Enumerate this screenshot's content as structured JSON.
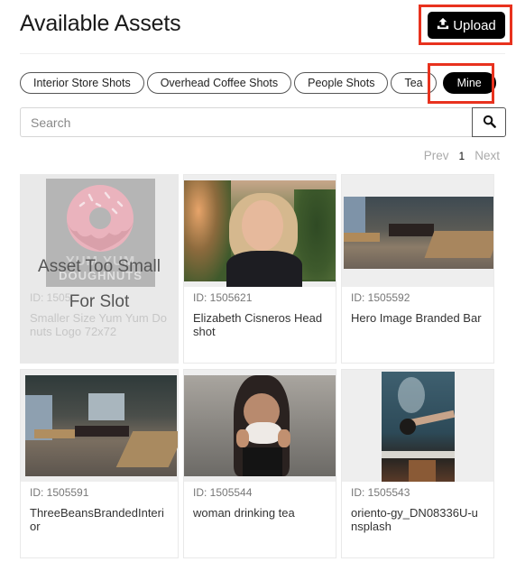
{
  "header": {
    "title": "Available Assets",
    "upload_label": "Upload",
    "upload_icon": "upload-icon"
  },
  "filters": [
    {
      "label": "Interior Store Shots",
      "active": false
    },
    {
      "label": "Overhead Coffee Shots",
      "active": false
    },
    {
      "label": "People Shots",
      "active": false
    },
    {
      "label": "Tea",
      "active": false
    },
    {
      "label": "Mine",
      "active": true
    }
  ],
  "search": {
    "placeholder": "Search",
    "value": "",
    "icon": "search-icon"
  },
  "pagination": {
    "prev_label": "Prev",
    "current_page": "1",
    "next_label": "Next"
  },
  "assets": [
    {
      "id_label": "ID: 1505...",
      "name": "Smaller Size Yum Yum Donuts Logo 72x72",
      "disabled": true,
      "overlay": "Asset Too Small For Slot",
      "logo_text": [
        "YUM YUM",
        "DOUGHNUTS"
      ]
    },
    {
      "id_label": "ID: 1505621",
      "name": "Elizabeth Cisneros Headshot",
      "disabled": false
    },
    {
      "id_label": "ID: 1505592",
      "name": "Hero Image Branded Bar",
      "disabled": false
    },
    {
      "id_label": "ID: 1505591",
      "name": "ThreeBeansBrandedInterior",
      "disabled": false
    },
    {
      "id_label": "ID: 1505544",
      "name": "woman drinking tea",
      "disabled": false
    },
    {
      "id_label": "ID: 1505543",
      "name": "oriento-gy_DN08336U-unsplash",
      "disabled": false
    }
  ],
  "colors": {
    "highlight": "#e8321e",
    "primary": "#000000"
  }
}
